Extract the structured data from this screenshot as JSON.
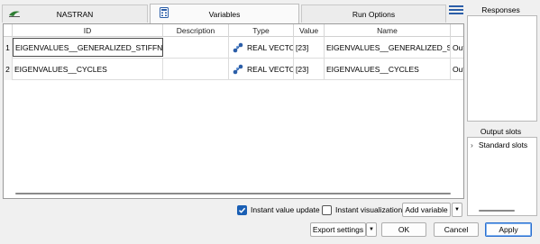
{
  "tabs": [
    {
      "label": "NASTRAN",
      "icon": "nastran-logo-icon",
      "active": false
    },
    {
      "label": "Variables",
      "icon": "calculator-icon",
      "active": true
    },
    {
      "label": "Run Options",
      "active": false
    }
  ],
  "table": {
    "columns": [
      "ID",
      "Description",
      "Type",
      "Value",
      "Name"
    ],
    "rows": [
      {
        "num": "1",
        "id": "EIGENVALUES__GENERALIZED_STIFFNESS",
        "description": "",
        "type": "REAL VECTOR",
        "type_icon": "vector-type-icon",
        "value": "[23]",
        "name": "EIGENVALUES__GENERALIZED_STIF...",
        "extra": "Out"
      },
      {
        "num": "2",
        "id": "EIGENVALUES__CYCLES",
        "description": "",
        "type": "REAL VECTOR",
        "type_icon": "vector-type-icon",
        "value": "[23]",
        "name": "EIGENVALUES__CYCLES",
        "extra": "Out"
      }
    ]
  },
  "responses": {
    "label": "Responses",
    "items": []
  },
  "output_slots": {
    "label": "Output slots",
    "items": [
      {
        "label": "Standard slots",
        "expanded": false
      }
    ]
  },
  "options": {
    "instant_value_update": {
      "label": "Instant value update",
      "checked": true
    },
    "instant_visualization": {
      "label": "Instant visualization",
      "checked": false
    }
  },
  "buttons": {
    "add_variable": "Add variable",
    "export_settings": "Export settings",
    "ok": "OK",
    "cancel": "Cancel",
    "apply": "Apply"
  },
  "colors": {
    "accent": "#1a5fb4",
    "icon_blue": "#2b5ea8"
  }
}
